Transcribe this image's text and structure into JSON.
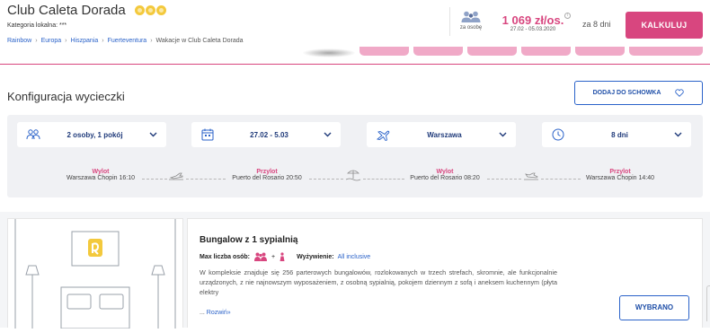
{
  "hotel": {
    "name": "Club Caleta Dorada",
    "category_label": "Kategoria lokalna: ***"
  },
  "breadcrumb": [
    "Rainbow",
    "Europa",
    "Hiszpania",
    "Fuerteventura",
    "Wakacje w Club Caleta Dorada"
  ],
  "header": {
    "persons_label": "za osobę",
    "price": "1 069 zł/os.",
    "price_dates": "27.02 - 05.03.2020",
    "info_symbol": "i",
    "duration": "za 8 dni",
    "calc_button": "KALKULUJ"
  },
  "config": {
    "title": "Konfiguracja wycieczki",
    "save_button": "DODAJ DO SCHOWKA",
    "selectors": {
      "persons": "2 osoby, 1 pokój",
      "dates": "27.02 - 5.03",
      "departure": "Warszawa",
      "length": "8 dni"
    },
    "route": [
      {
        "label": "Wylot",
        "detail": "Warszawa Chopin 16:10"
      },
      {
        "label": "Przylot",
        "detail": "Puerto del Rosario 20:50"
      },
      {
        "label": "Wylot",
        "detail": "Puerto del Rosario 08:20"
      },
      {
        "label": "Przylot",
        "detail": "Warszawa Chopin 14:40"
      }
    ]
  },
  "room": {
    "title": "Bungalow z 1 sypialnią",
    "max_label": "Max liczba osób:",
    "plus": "+",
    "board_label": "Wyżywienie:",
    "board_value": "All inclusive",
    "description": "W kompleksie znajduje się 256 parterowych bungalowów, rozlokowanych w trzech strefach, skromnie, ale funkcjonalnie urządzonych, z nie najnowszym wyposażeniem, z osobną sypialnią, pokojem dziennym z sofą i aneksem kuchennym (płyta elektry",
    "more_prefix": "...",
    "more_link": "Rozwiń»",
    "chosen_button": "WYBRANO"
  },
  "colors": {
    "accent": "#d8467f",
    "link": "#2a62c9",
    "navy": "#1f3a7a"
  }
}
